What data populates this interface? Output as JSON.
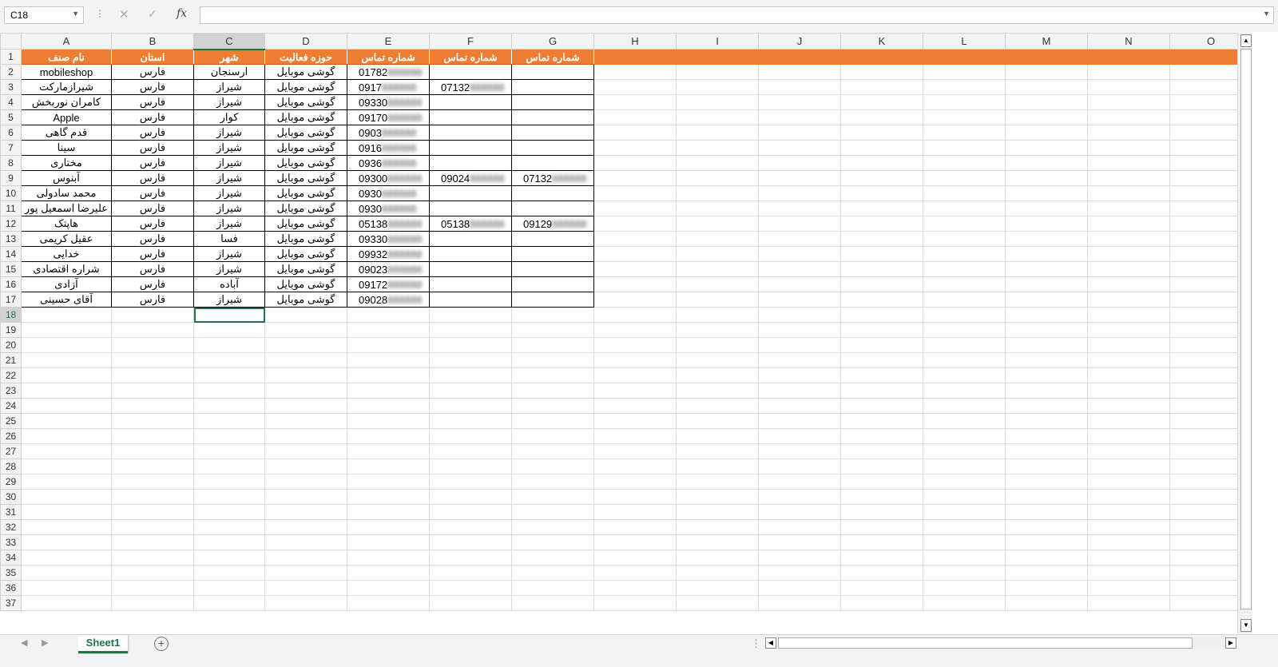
{
  "formula_bar": {
    "name_box": "C18",
    "cancel_icon": "✕",
    "enter_icon": "✓",
    "fx_label": "fx",
    "formula": ""
  },
  "columns": [
    "A",
    "B",
    "C",
    "D",
    "E",
    "F",
    "G",
    "H",
    "I",
    "J",
    "K",
    "L",
    "M",
    "N",
    "O"
  ],
  "selected_cell": {
    "column": "C",
    "row": 18
  },
  "header_row": [
    "نام صنف",
    "استان",
    "شهر",
    "حوزه فعالیت",
    "شماره تماس",
    "شماره تماس",
    "شماره تماس"
  ],
  "rows": [
    [
      "mobileshop",
      "فارس",
      "ارسنجان",
      "گوشی موبایل",
      "01782",
      "",
      ""
    ],
    [
      "شیرازمارکت",
      "فارس",
      "شیراز",
      "گوشی موبایل",
      "0917",
      "07132",
      ""
    ],
    [
      "کامران نوربخش",
      "فارس",
      "شیراز",
      "گوشی موبایل",
      "09330",
      "",
      ""
    ],
    [
      "Apple",
      "فارس",
      "کوار",
      "گوشی موبایل",
      "09170",
      "",
      ""
    ],
    [
      "قدم گاهی",
      "فارس",
      "شیراز",
      "گوشی موبایل",
      "0903",
      "",
      ""
    ],
    [
      "سینا",
      "فارس",
      "شیراز",
      "گوشی موبایل",
      "0916",
      "",
      ""
    ],
    [
      "مختاری",
      "فارس",
      "شیراز",
      "گوشی موبایل",
      "0936",
      "",
      ""
    ],
    [
      "آبنوس",
      "فارس",
      "شیراز",
      "گوشی موبایل",
      "09300",
      "09024",
      "07132"
    ],
    [
      "محمد سادولی",
      "فارس",
      "شیراز",
      "گوشی موبایل",
      "0930",
      "",
      ""
    ],
    [
      "علیرضا اسمعیل پور",
      "فارس",
      "شیراز",
      "گوشی موبایل",
      "0930",
      "",
      ""
    ],
    [
      "هاپتک",
      "فارس",
      "شیراز",
      "گوشی موبایل",
      "05138",
      "05138",
      "09129"
    ],
    [
      "عقیل کریمی",
      "فارس",
      "فسا",
      "گوشی موبایل",
      "09330",
      "",
      ""
    ],
    [
      "خدایی",
      "فارس",
      "شیراز",
      "گوشی موبایل",
      "09932",
      "",
      ""
    ],
    [
      "شراره اقتصادی",
      "فارس",
      "شیراز",
      "گوشی موبایل",
      "09023",
      "",
      ""
    ],
    [
      "آزادی",
      "فارس",
      "آباده",
      "گوشی موبایل",
      "09172",
      "",
      ""
    ],
    [
      "آقای حسینی",
      "فارس",
      "شیراز",
      "گوشی موبایل",
      "09028",
      "",
      ""
    ]
  ],
  "sheet_tabs": [
    "Sheet1"
  ],
  "add_sheet_icon": "+",
  "total_visible_rows": 37
}
